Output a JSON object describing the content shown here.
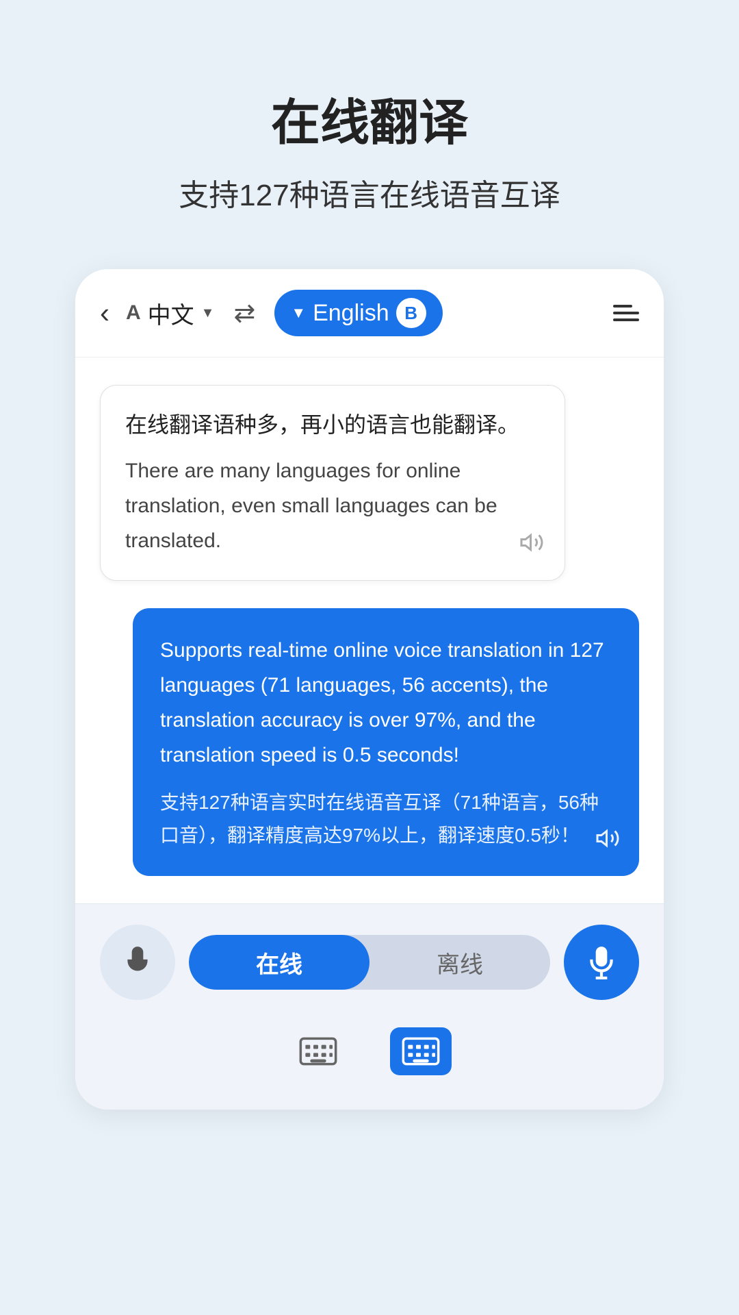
{
  "header": {
    "title": "在线翻译",
    "subtitle": "支持127种语言在线语音互译"
  },
  "toolbar": {
    "lang_a_letter": "A",
    "lang_a_name": "中文",
    "swap_icon": "⇌",
    "lang_b_name": "English",
    "lang_b_letter": "B",
    "menu_label": "menu"
  },
  "chat": {
    "bubble_left": {
      "source_text": "在线翻译语种多，再小的语言也能翻译。",
      "translated_text": "There are many languages for online translation, even small languages can be translated."
    },
    "bubble_right": {
      "english_text": "Supports real-time online voice translation in 127 languages (71 languages, 56 accents), the translation accuracy is over 97%, and the translation speed is 0.5 seconds!",
      "chinese_text": "支持127种语言实时在线语音互译（71种语言，56种口音），翻译精度高达97%以上，翻译速度0.5秒！"
    }
  },
  "bottom": {
    "mode_online": "在线",
    "mode_offline": "离线"
  }
}
